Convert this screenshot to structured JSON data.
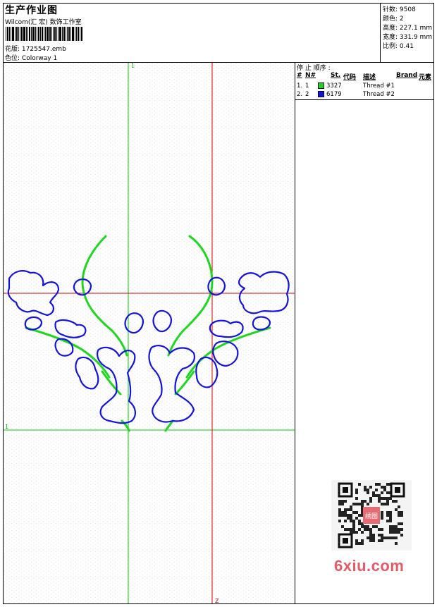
{
  "header": {
    "title": "生产作业图",
    "studio": "Wilcom(汇 宏) 数饰工作室",
    "design_label": "花版:",
    "design_value": "1725547.emb",
    "color_label": "色位:",
    "color_value": "Colorway 1"
  },
  "stats": {
    "stitches_label": "针数:",
    "stitches_value": "9508",
    "colors_label": "颜色:",
    "colors_value": "2",
    "height_label": "高度:",
    "height_value": "227.1 mm",
    "width_label": "宽度:",
    "width_value": "331.9 mm",
    "scale_label": "比例:",
    "scale_value": "0.41"
  },
  "legend": {
    "stop_sequence_label": "停 止 顺序 :",
    "columns": {
      "index": "#",
      "n": "N#",
      "st": "St.",
      "code": "代码",
      "desc": "描述",
      "brand": "Brand",
      "element": "元素"
    },
    "rows": [
      {
        "index": "1.",
        "n": "1",
        "code": "3327",
        "desc": "Thread #1",
        "color": "#1ed81e"
      },
      {
        "index": "2.",
        "n": "2",
        "code": "6179",
        "desc": "Thread #2",
        "color": "#1414e0"
      }
    ]
  },
  "axes": {
    "top_marker": "1",
    "left_marker": "1",
    "bottom_marker": "Z"
  },
  "colors": {
    "green_thread": "#1ed81e",
    "blue_thread": "#1414e0",
    "guide_green": "#00cc00",
    "guide_red": "#dd0000"
  },
  "watermark": {
    "brand": "6xiu.com",
    "qr_text": "绣图"
  }
}
